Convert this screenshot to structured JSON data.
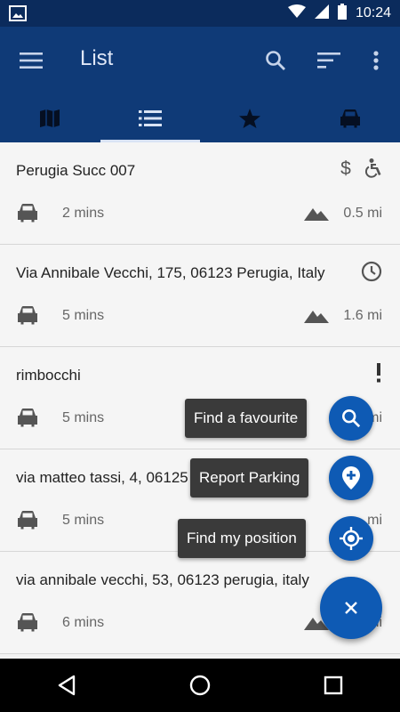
{
  "status_bar": {
    "time": "10:24"
  },
  "app_bar": {
    "title": "List"
  },
  "tabs": [
    "map-icon",
    "list-icon",
    "star-icon",
    "car-icon"
  ],
  "active_tab": 1,
  "list": [
    {
      "title": "Perugia Succ 007",
      "duration": "2 mins",
      "distance": "0.5 mi",
      "icons": [
        "dollar-icon",
        "accessible-icon"
      ]
    },
    {
      "title": "Via Annibale Vecchi, 175, 06123 Perugia, Italy",
      "duration": "5 mins",
      "distance": "1.6 mi",
      "icons": [
        "clock-icon"
      ]
    },
    {
      "title": "rimbocchi",
      "duration": "5 mins",
      "distance": "mi",
      "icons": [
        "exclamation-icon"
      ]
    },
    {
      "title": "via matteo tassi, 4, 06125",
      "duration": "5 mins",
      "distance": "mi",
      "icons": []
    },
    {
      "title": "via annibale vecchi, 53, 06123 perugia, italy",
      "duration": "6 mins",
      "distance": "mi",
      "icons": []
    }
  ],
  "fab_menu": {
    "find_favourite": "Find a favourite",
    "report_parking": "Report Parking",
    "find_position": "Find my position"
  },
  "colors": {
    "status_bar": "#0b2b5c",
    "app_bar": "#0f3a77",
    "fab": "#0e5ab4"
  }
}
